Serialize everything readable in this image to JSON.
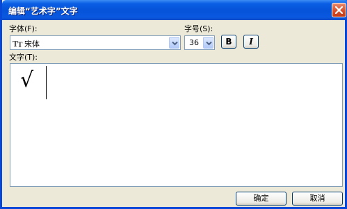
{
  "window": {
    "title": "编辑“艺术字”文字"
  },
  "font": {
    "label": "字体(F):",
    "value": "宋体",
    "type_icon": "Tt"
  },
  "size": {
    "label": "字号(S):",
    "value": "36"
  },
  "format": {
    "bold_label": "B",
    "italic_label": "I"
  },
  "text": {
    "label": "文字(T):",
    "content": "√"
  },
  "buttons": {
    "ok": "确定",
    "cancel": "取消"
  },
  "icons": {
    "close": "close-icon",
    "dropdown": "chevron-down-icon",
    "font_type": "truetype-font-icon"
  },
  "colors": {
    "titlebar": "#0553d8",
    "dialog_bg": "#ece9d8",
    "close": "#d6502c"
  }
}
